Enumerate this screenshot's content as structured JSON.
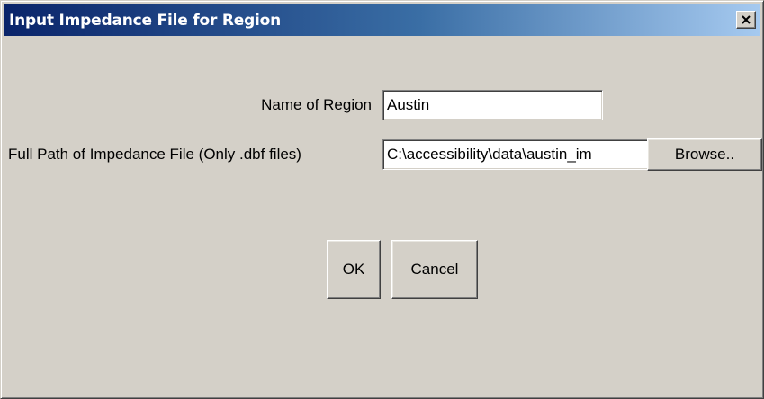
{
  "window": {
    "title": "Input Impedance File for Region",
    "close_glyph": "×",
    "close_icon": "close-icon"
  },
  "form": {
    "region_label": "Name of Region",
    "region_value": "Austin",
    "path_label": "Full Path of Impedance File (Only .dbf files)",
    "path_value": "C:\\accessibility\\data\\austin_im",
    "browse_label": "Browse.."
  },
  "buttons": {
    "ok_label": "OK",
    "cancel_label": "Cancel"
  },
  "colors": {
    "background": "#d4d0c8",
    "titlebar_start": "#0a246a",
    "titlebar_end": "#a6caf0",
    "title_text": "#ffffff"
  }
}
